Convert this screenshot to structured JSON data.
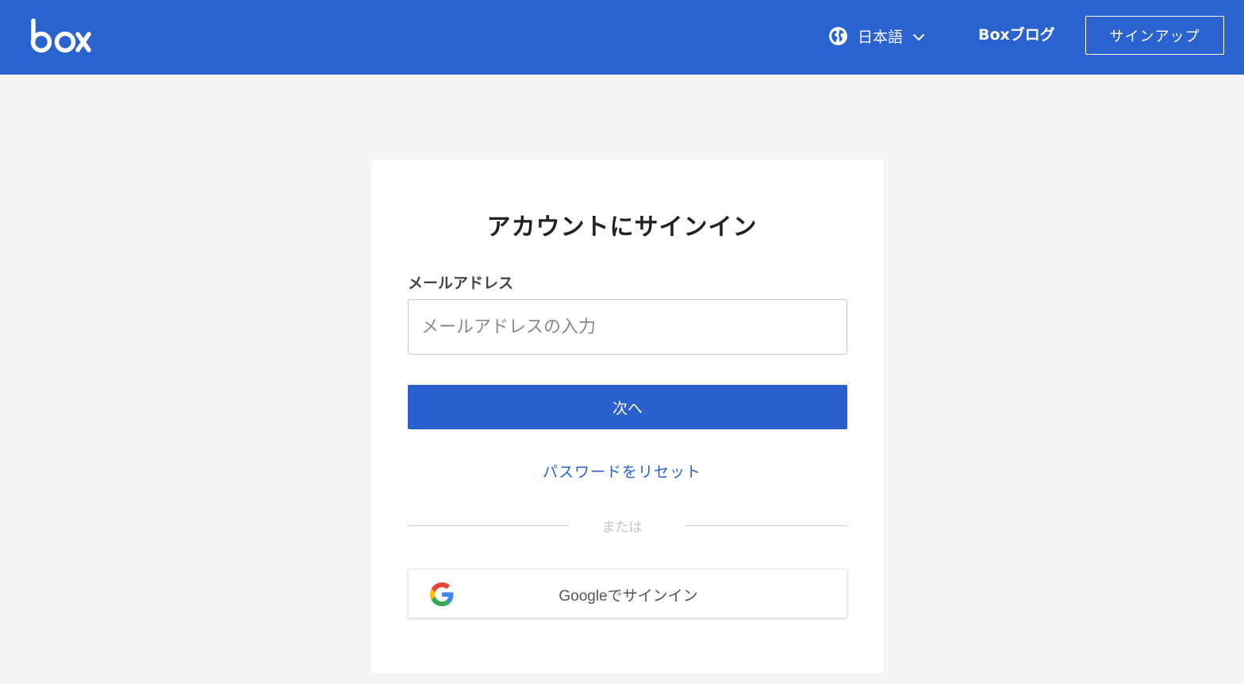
{
  "header": {
    "logo_text": "box",
    "language_icon": "globe-icon",
    "language_label": "日本語",
    "language_chevron_icon": "chevron-down-icon",
    "blog_label": "Boxブログ",
    "signup_label": "サインアップ",
    "bg_color": "#2a62d0"
  },
  "signin": {
    "title": "アカウントにサインイン",
    "email_label": "メールアドレス",
    "email_placeholder": "メールアドレスの入力",
    "email_value": "",
    "next_label": "次へ",
    "reset_label": "パスワードをリセット",
    "or_label": "または",
    "google_icon": "google-g-icon",
    "google_label": "Googleでサインイン"
  },
  "colors": {
    "primary": "#2a5fcc",
    "link": "#2a62d0",
    "page_bg": "#f4f4f4"
  }
}
